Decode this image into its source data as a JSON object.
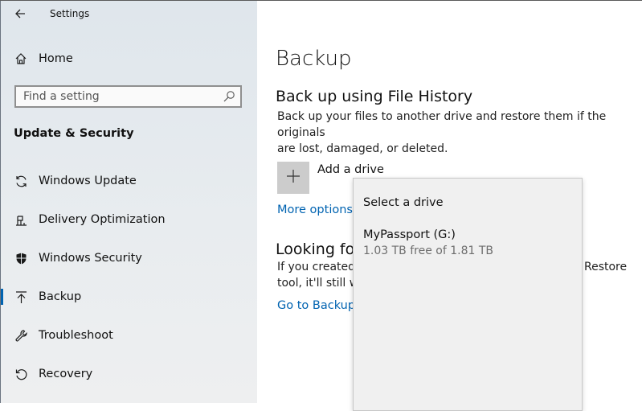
{
  "window": {
    "title": "Settings"
  },
  "sidebar": {
    "home_label": "Home",
    "search_placeholder": "Find a setting",
    "section_title": "Update & Security",
    "items": [
      {
        "label": "Windows Update",
        "icon": "sync-icon"
      },
      {
        "label": "Delivery Optimization",
        "icon": "delivery-optimization-icon"
      },
      {
        "label": "Windows Security",
        "icon": "shield-icon"
      },
      {
        "label": "Backup",
        "icon": "backup-arrow-icon",
        "active": true
      },
      {
        "label": "Troubleshoot",
        "icon": "wrench-icon"
      },
      {
        "label": "Recovery",
        "icon": "recovery-icon"
      }
    ]
  },
  "main": {
    "title": "Backup",
    "file_history": {
      "heading": "Back up using File History",
      "description_line1": "Back up your files to another drive and restore them if the originals",
      "description_line2": "are lost, damaged, or deleted.",
      "add_drive_label": "Add a drive",
      "more_options_label": "More options"
    },
    "looking": {
      "heading": "Looking fo",
      "text_line1_left": "If you created",
      "text_line1_right": "Restore",
      "text_line2": "tool, it'll still w",
      "link_label": "Go to Backup"
    }
  },
  "flyout": {
    "title": "Select a drive",
    "drives": [
      {
        "name": "MyPassport (G:)",
        "free": "1.03 TB free of 1.81 TB"
      }
    ]
  },
  "colors": {
    "accent": "#0063b1",
    "sidebar_bg": "#e4e9ed",
    "flyout_bg": "#f0f0f0"
  }
}
